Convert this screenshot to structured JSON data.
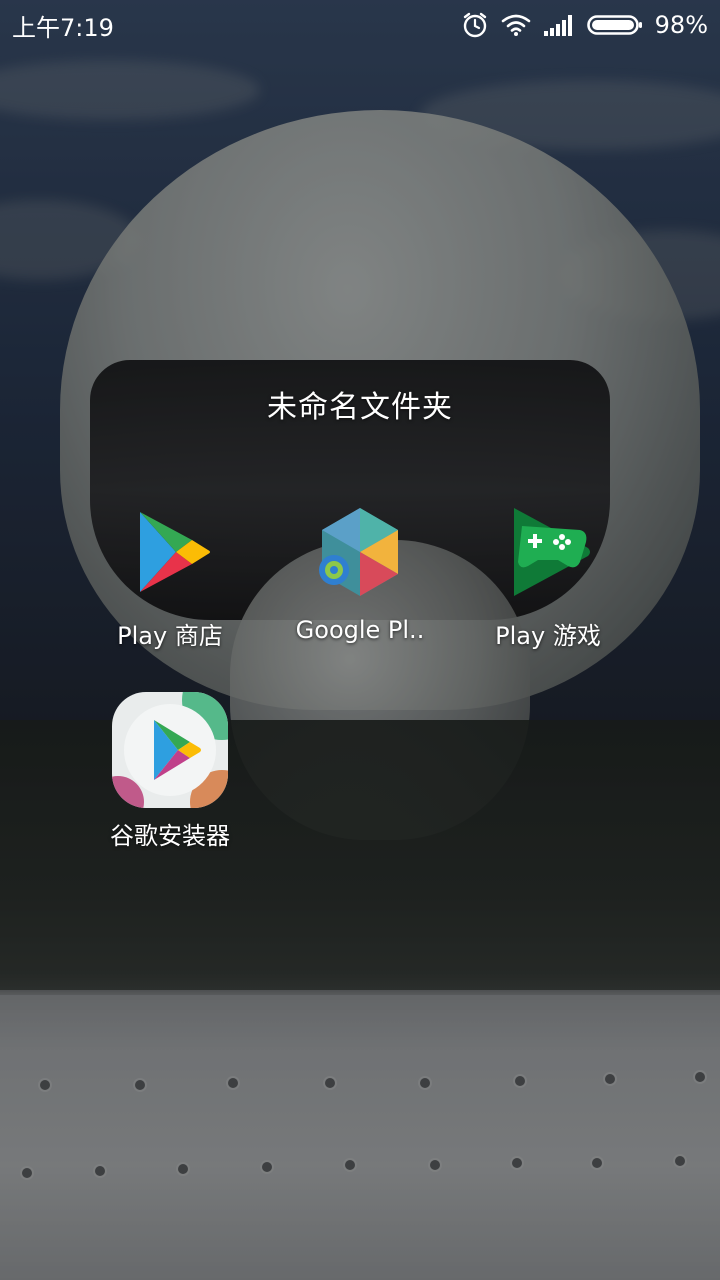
{
  "status_bar": {
    "time": "上午7:19",
    "battery_percent": "98%",
    "icons": [
      "alarm-icon",
      "wifi-icon",
      "signal-icon",
      "battery-icon"
    ]
  },
  "folder": {
    "title": "未命名文件夹",
    "apps": [
      {
        "label": "Play 商店",
        "icon": "play-store-icon"
      },
      {
        "label": "Google Pl..",
        "icon": "google-play-services-icon"
      },
      {
        "label": "Play 游戏",
        "icon": "play-games-icon"
      },
      {
        "label": "谷歌安装器",
        "icon": "google-installer-icon"
      }
    ]
  },
  "colors": {
    "play_blue": "#2e9fe0",
    "play_green": "#34a853",
    "play_yellow": "#fbbc05",
    "play_red": "#e8334a",
    "games_green": "#1a9a4a"
  }
}
